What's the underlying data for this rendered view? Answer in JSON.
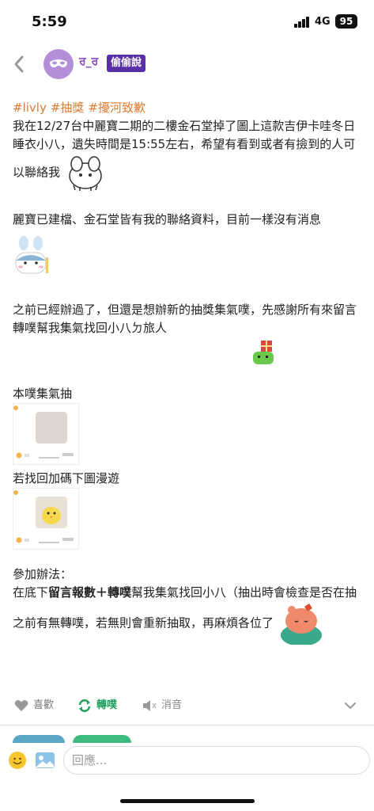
{
  "status_bar": {
    "time": "5:59",
    "network": "4G",
    "battery": "95"
  },
  "header": {
    "username": "ਰ_ਰ",
    "badge": "偷偷說"
  },
  "post": {
    "tags": [
      "#livly",
      "#抽獎",
      "#擾河致歉"
    ],
    "p1": "我在12/27台中麗寶二期的二樓金石堂掉了圖上這款吉伊卡哇冬日睡衣小八，遺失時間是15:55左右，希望有看到或者有撿到的人可以聯絡我",
    "p2": "麗寶已建檔、金石堂皆有我的聯絡資料，目前一樣沒有消息",
    "p3": "之前已經辦過了，但還是想辦新的抽獎集氣噗，先感謝所有來留言轉噗幫我集氣找回小八ㄉ旅人",
    "p4": "本噗集氣抽",
    "p5": "若找回加碼下圖漫遊",
    "p6": "參加辦法：",
    "p7_pre": "在底下",
    "p7_bold": "留言報數＋轉噗",
    "p7_post": "幫我集氣找回小八（抽出時會檢查是否在抽之前有無轉噗，若無則會重新抽取，再麻煩各位了"
  },
  "actions": {
    "like": "喜歡",
    "replurk": "轉噗",
    "mute": "消音"
  },
  "reply": {
    "placeholder": "回應..."
  },
  "colors": {
    "tag": "#e07a2f",
    "badge": "#5a2ea6",
    "replurk": "#23a060"
  }
}
